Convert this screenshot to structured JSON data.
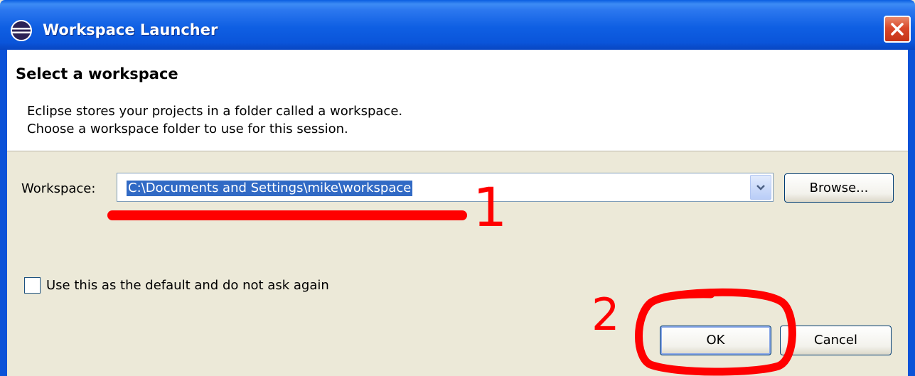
{
  "window": {
    "title": "Workspace Launcher",
    "close_icon": "close-icon"
  },
  "header": {
    "title": "Select a workspace",
    "description_line1": "Eclipse stores your projects in a folder called a workspace.",
    "description_line2": "Choose a workspace folder to use for this session."
  },
  "workspace": {
    "label": "Workspace:",
    "value": "C:\\Documents and Settings\\mike\\workspace",
    "browse_label": "Browse..."
  },
  "options": {
    "default_checkbox_label": "Use this as the default and do not ask again",
    "default_checked": false
  },
  "buttons": {
    "ok_label": "OK",
    "cancel_label": "Cancel"
  },
  "annotations": {
    "step1": "1",
    "step2": "2",
    "color": "#ff0000"
  },
  "colors": {
    "titlebar": "#0a5ee0",
    "selection": "#316ac5",
    "dialog_bg": "#ece9d8"
  }
}
